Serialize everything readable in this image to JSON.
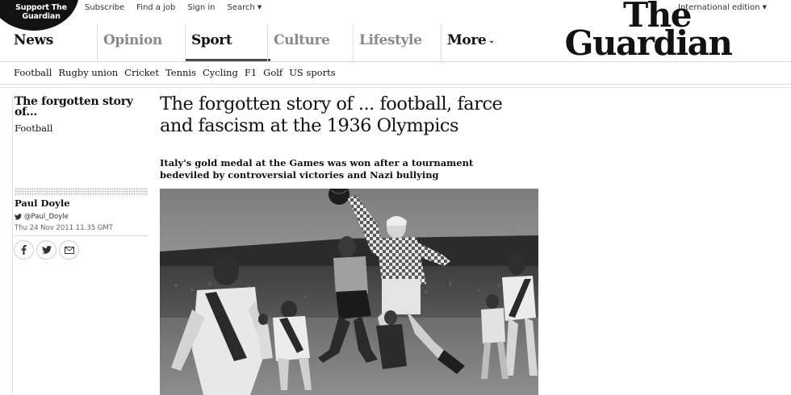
{
  "top": {
    "support_line1": "Support The",
    "support_line2": "Guardian",
    "links": [
      "Subscribe",
      "Find a job",
      "Sign in",
      "Search"
    ],
    "edition": "International edition"
  },
  "logo": {
    "line1": "The",
    "line2": "Guardian"
  },
  "pillars": [
    "News",
    "Opinion",
    "Sport",
    "Culture",
    "Lifestyle",
    "More"
  ],
  "subnav": [
    "Football",
    "Rugby union",
    "Cricket",
    "Tennis",
    "Cycling",
    "F1",
    "Golf",
    "US sports"
  ],
  "article": {
    "series": "The forgotten story of...",
    "section": "Football",
    "headline": "The forgotten story of ... football, farce and fascism at the 1936 Olympics",
    "standfirst": "Italy's gold medal at the Games was won after a tournament bedeviled by controversial victories and Nazi bullying",
    "author": "Paul Doyle",
    "twitter": "@Paul_Doyle",
    "date": "Thu 24 Nov 2011 11.35 GMT"
  },
  "share_icons": [
    "facebook-icon",
    "twitter-icon",
    "email-icon"
  ],
  "icons": {
    "search_caret": "chevron-down-icon",
    "edition_caret": "chevron-down-icon",
    "more_caret": "chevron-down-icon",
    "twitter": "twitter-icon"
  },
  "colors": {
    "text": "#121212",
    "muted_nav": "#8a8a8a",
    "rule": "#dcdcdc",
    "badge": "#121212"
  }
}
